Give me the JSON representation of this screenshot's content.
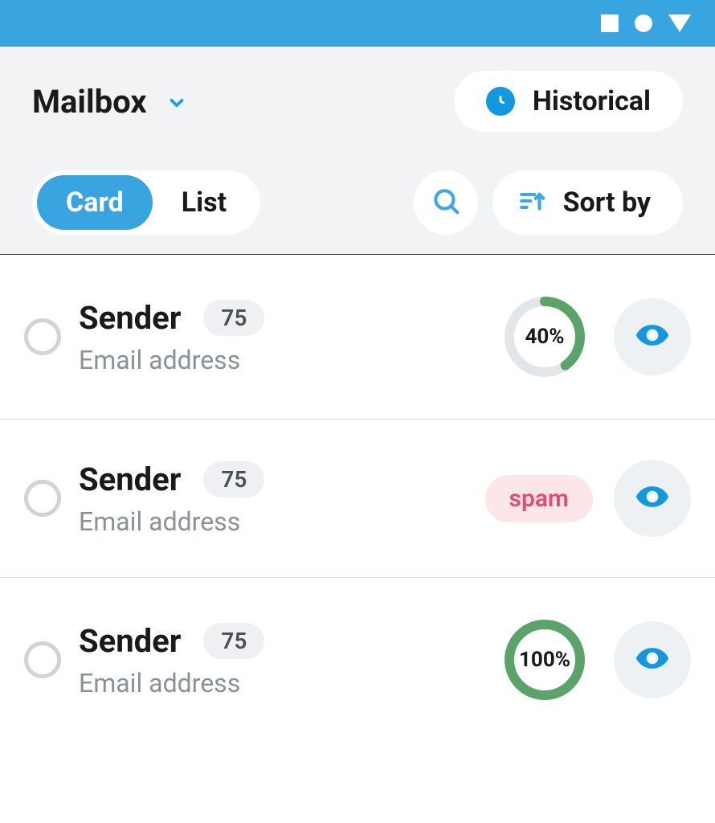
{
  "colors": {
    "accent": "#38a5e0",
    "green": "#5aa469",
    "ringBg": "#e3e6e9"
  },
  "header": {
    "title": "Mailbox",
    "historical_label": "Historical",
    "view_card": "Card",
    "view_list": "List",
    "sort_label": "Sort by"
  },
  "rows": [
    {
      "sender": "Sender",
      "badge": "75",
      "email": "Email address",
      "status_type": "ring",
      "percent": 40,
      "percent_label": "40%"
    },
    {
      "sender": "Sender",
      "badge": "75",
      "email": "Email address",
      "status_type": "spam",
      "spam_label": "spam"
    },
    {
      "sender": "Sender",
      "badge": "75",
      "email": "Email address",
      "status_type": "ring",
      "percent": 100,
      "percent_label": "100%"
    }
  ]
}
